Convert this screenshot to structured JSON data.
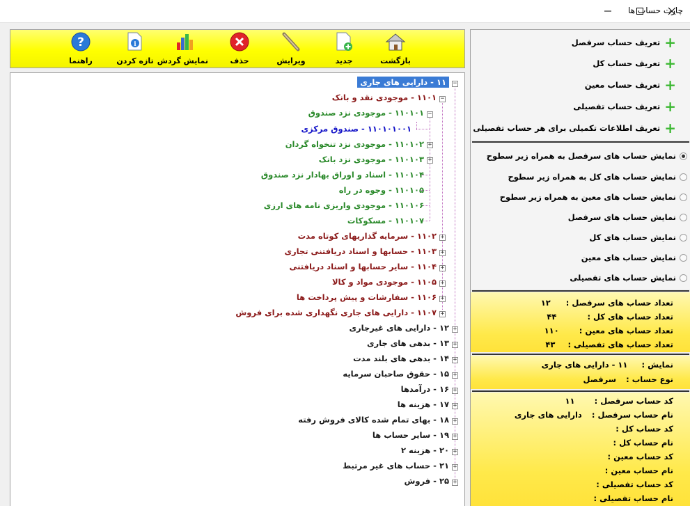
{
  "window": {
    "title": "چارت حساب ها"
  },
  "toolbar": {
    "back": "بازگشت",
    "new": "جدید",
    "edit": "ویرایش",
    "delete": "حذف",
    "show_turnover": "نمایش گردش",
    "refresh": "تازه کردن",
    "help": "راهنما"
  },
  "tree": {
    "nodes": [
      "۱۱ - دارایی های جاری",
      "۱۱۰۱ - موجودی نقد و بانک",
      "۱۱۰۱۰۱ - موجودی نزد صندوق",
      "۱۱۰۱۰۱۰۰۱ - صندوق مرکزی",
      "۱۱۰۱۰۲ - موجودی نزد تنخواه گردان",
      "۱۱۰۱۰۳ - موجودی نزد بانک",
      "۱۱۰۱۰۴ - اسناد و اوراق بهادار نزد صندوق",
      "۱۱۰۱۰۵ - وجوه در راه",
      "۱۱۰۱۰۶ - موجودی واریزی نامه های ارزی",
      "۱۱۰۱۰۷ - مسکوکات",
      "۱۱۰۲ - سرمایه گذاریهای کوتاه مدت",
      "۱۱۰۳ - حسابها و اسناد دریافتنی تجاری",
      "۱۱۰۴ - سایر حسابها و اسناد دریافتنی",
      "۱۱۰۵ - موجودی مواد و کالا",
      "۱۱۰۶ - سفارشات و پیش پرداخت ها",
      "۱۱۰۷ - دارایی های جاری نگهداری شده برای فروش",
      "۱۲ - دارایی های غیرجاری",
      "۱۳ - بدهی های جاری",
      "۱۴ - بدهی های بلند مدت",
      "۱۵ - حقوق صاحبان سرمایه",
      "۱۶ - درآمدها",
      "۱۷ - هزینه ها",
      "۱۸ - بهای تمام شده کالای فروش رفته",
      "۱۹ - سایر حساب ها",
      "۲۰ - هزینه ۲",
      "۲۱ - حساب های غیر مرتبط",
      "۲۵ - فروش"
    ]
  },
  "define": {
    "items": [
      "تعریف حساب سرفصل",
      "تعریف حساب کل",
      "تعریف حساب معین",
      "تعریف حساب تفصیلی",
      "تعریف اطلاعات تکمیلی برای هر حساب تفصیلی"
    ]
  },
  "display_options": {
    "items": [
      "نمایش حساب های سرفصل به همراه زیر سطوح",
      "نمایش حساب های کل به همراه زیر سطوح",
      "نمایش حساب های معین به همراه زیر سطوح",
      "نمایش حساب های سرفصل",
      "نمایش حساب های کل",
      "نمایش حساب های معین",
      "نمایش حساب های تفصیلی"
    ]
  },
  "counts": {
    "header_label": "تعداد حساب های سرفصل :",
    "header_value": "۱۲",
    "total_label": "تعداد حساب های کل :",
    "total_value": "۴۴",
    "moein_label": "تعداد حساب های معین :",
    "moein_value": "۱۱۰",
    "detail_label": "تعداد حساب های تفصیلی :",
    "detail_value": "۴۳"
  },
  "view": {
    "show_label": "نمایش :",
    "show_value": "۱۱ - دارایی های جاری",
    "type_label": "نوع حساب :",
    "type_value": "سرفصل"
  },
  "details": {
    "header_code_label": "کد حساب سرفصل :",
    "header_code_value": "۱۱",
    "header_name_label": "نام حساب سرفصل :",
    "header_name_value": "دارایی های جاری",
    "total_code_label": "کد حساب کل :",
    "total_name_label": "نام حساب کل :",
    "moein_code_label": "کد حساب معین :",
    "moein_name_label": "نام حساب معین :",
    "detail_code_label": "کد حساب تفصیلی :",
    "detail_name_label": "نام حساب تفصیلی :"
  }
}
